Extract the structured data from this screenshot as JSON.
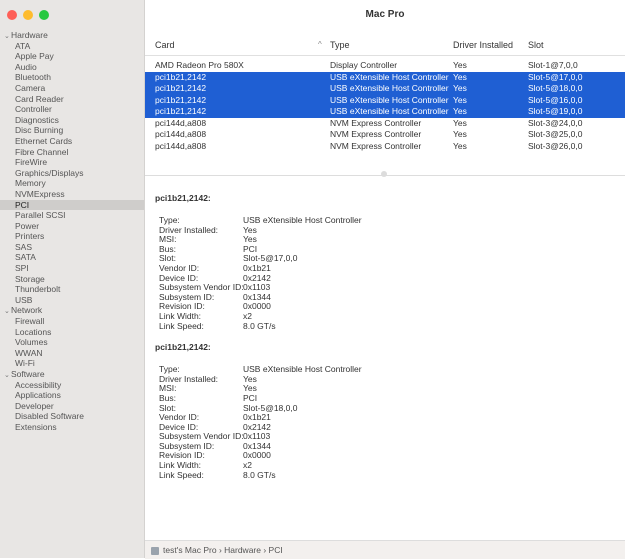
{
  "window": {
    "title": "Mac Pro",
    "traffic_lights": {
      "close": "#fe5f57",
      "minimize": "#febc2e",
      "zoom": "#28c840"
    }
  },
  "sidebar": {
    "groups": [
      {
        "label": "Hardware",
        "expanded": true,
        "items": [
          "ATA",
          "Apple Pay",
          "Audio",
          "Bluetooth",
          "Camera",
          "Card Reader",
          "Controller",
          "Diagnostics",
          "Disc Burning",
          "Ethernet Cards",
          "Fibre Channel",
          "FireWire",
          "Graphics/Displays",
          "Memory",
          "NVMExpress",
          "PCI",
          "Parallel SCSI",
          "Power",
          "Printers",
          "SAS",
          "SATA",
          "SPI",
          "Storage",
          "Thunderbolt",
          "USB"
        ]
      },
      {
        "label": "Network",
        "expanded": true,
        "items": [
          "Firewall",
          "Locations",
          "Volumes",
          "WWAN",
          "Wi-Fi"
        ]
      },
      {
        "label": "Software",
        "expanded": true,
        "items": [
          "Accessibility",
          "Applications",
          "Developer",
          "Disabled Software",
          "Extensions"
        ]
      }
    ],
    "selected": "PCI"
  },
  "table": {
    "columns": [
      "Card",
      "Type",
      "Driver Installed",
      "Slot"
    ],
    "sort_indicator": "^",
    "rows": [
      {
        "card": "AMD Radeon Pro 580X",
        "type": "Display Controller",
        "driver": "Yes",
        "slot": "Slot-1@7,0,0",
        "selected": false
      },
      {
        "card": "pci1b21,2142",
        "type": "USB eXtensible Host Controller",
        "driver": "Yes",
        "slot": "Slot-5@17,0,0",
        "selected": true
      },
      {
        "card": "pci1b21,2142",
        "type": "USB eXtensible Host Controller",
        "driver": "Yes",
        "slot": "Slot-5@18,0,0",
        "selected": true
      },
      {
        "card": "pci1b21,2142",
        "type": "USB eXtensible Host Controller",
        "driver": "Yes",
        "slot": "Slot-5@16,0,0",
        "selected": true
      },
      {
        "card": "pci1b21,2142",
        "type": "USB eXtensible Host Controller",
        "driver": "Yes",
        "slot": "Slot-5@19,0,0",
        "selected": true
      },
      {
        "card": "pci144d,a808",
        "type": "NVM Express Controller",
        "driver": "Yes",
        "slot": "Slot-3@24,0,0",
        "selected": false
      },
      {
        "card": "pci144d,a808",
        "type": "NVM Express Controller",
        "driver": "Yes",
        "slot": "Slot-3@25,0,0",
        "selected": false
      },
      {
        "card": "pci144d,a808",
        "type": "NVM Express Controller",
        "driver": "Yes",
        "slot": "Slot-3@26,0,0",
        "selected": false
      }
    ],
    "selection_color": "#1f5fd3"
  },
  "details": [
    {
      "title": "pci1b21,2142:",
      "props": [
        {
          "k": "Type:",
          "v": "USB eXtensible Host Controller"
        },
        {
          "k": "Driver Installed:",
          "v": "Yes"
        },
        {
          "k": "MSI:",
          "v": "Yes"
        },
        {
          "k": "Bus:",
          "v": "PCI"
        },
        {
          "k": "Slot:",
          "v": "Slot-5@17,0,0"
        },
        {
          "k": "Vendor ID:",
          "v": "0x1b21"
        },
        {
          "k": "Device ID:",
          "v": "0x2142"
        },
        {
          "k": "Subsystem Vendor ID:",
          "v": "0x1103"
        },
        {
          "k": "Subsystem ID:",
          "v": "0x1344"
        },
        {
          "k": "Revision ID:",
          "v": "0x0000"
        },
        {
          "k": "Link Width:",
          "v": "x2"
        },
        {
          "k": "Link Speed:",
          "v": "8.0 GT/s"
        }
      ]
    },
    {
      "title": "pci1b21,2142:",
      "props": [
        {
          "k": "Type:",
          "v": "USB eXtensible Host Controller"
        },
        {
          "k": "Driver Installed:",
          "v": "Yes"
        },
        {
          "k": "MSI:",
          "v": "Yes"
        },
        {
          "k": "Bus:",
          "v": "PCI"
        },
        {
          "k": "Slot:",
          "v": "Slot-5@18,0,0"
        },
        {
          "k": "Vendor ID:",
          "v": "0x1b21"
        },
        {
          "k": "Device ID:",
          "v": "0x2142"
        },
        {
          "k": "Subsystem Vendor ID:",
          "v": "0x1103"
        },
        {
          "k": "Subsystem ID:",
          "v": "0x1344"
        },
        {
          "k": "Revision ID:",
          "v": "0x0000"
        },
        {
          "k": "Link Width:",
          "v": "x2"
        },
        {
          "k": "Link Speed:",
          "v": "8.0 GT/s"
        }
      ]
    }
  ],
  "statusbar": {
    "icon": "computer-icon",
    "path": "test's Mac Pro › Hardware › PCI"
  }
}
